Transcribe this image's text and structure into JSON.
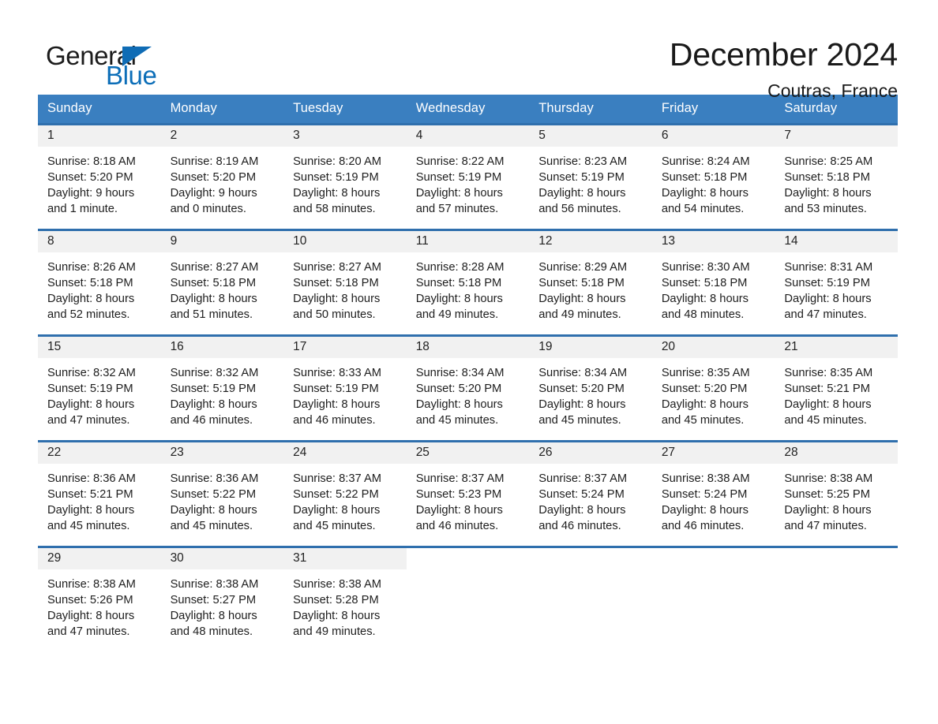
{
  "brand": {
    "name_part1": "General",
    "name_part2": "Blue",
    "triangle_color": "#0f6cb5",
    "blue_color": "#0c6eb8"
  },
  "header": {
    "month_title": "December 2024",
    "location": "Coutras, France"
  },
  "theme": {
    "header_blue": "#3a7fc0",
    "row_divider_blue": "#2f6fad",
    "daynum_band": "#f1f1f1"
  },
  "calendar": {
    "weekday_headers": [
      "Sunday",
      "Monday",
      "Tuesday",
      "Wednesday",
      "Thursday",
      "Friday",
      "Saturday"
    ],
    "weeks": [
      [
        {
          "day": "1",
          "sunrise": "Sunrise: 8:18 AM",
          "sunset": "Sunset: 5:20 PM",
          "daylight_line1": "Daylight: 9 hours",
          "daylight_line2": "and 1 minute."
        },
        {
          "day": "2",
          "sunrise": "Sunrise: 8:19 AM",
          "sunset": "Sunset: 5:20 PM",
          "daylight_line1": "Daylight: 9 hours",
          "daylight_line2": "and 0 minutes."
        },
        {
          "day": "3",
          "sunrise": "Sunrise: 8:20 AM",
          "sunset": "Sunset: 5:19 PM",
          "daylight_line1": "Daylight: 8 hours",
          "daylight_line2": "and 58 minutes."
        },
        {
          "day": "4",
          "sunrise": "Sunrise: 8:22 AM",
          "sunset": "Sunset: 5:19 PM",
          "daylight_line1": "Daylight: 8 hours",
          "daylight_line2": "and 57 minutes."
        },
        {
          "day": "5",
          "sunrise": "Sunrise: 8:23 AM",
          "sunset": "Sunset: 5:19 PM",
          "daylight_line1": "Daylight: 8 hours",
          "daylight_line2": "and 56 minutes."
        },
        {
          "day": "6",
          "sunrise": "Sunrise: 8:24 AM",
          "sunset": "Sunset: 5:18 PM",
          "daylight_line1": "Daylight: 8 hours",
          "daylight_line2": "and 54 minutes."
        },
        {
          "day": "7",
          "sunrise": "Sunrise: 8:25 AM",
          "sunset": "Sunset: 5:18 PM",
          "daylight_line1": "Daylight: 8 hours",
          "daylight_line2": "and 53 minutes."
        }
      ],
      [
        {
          "day": "8",
          "sunrise": "Sunrise: 8:26 AM",
          "sunset": "Sunset: 5:18 PM",
          "daylight_line1": "Daylight: 8 hours",
          "daylight_line2": "and 52 minutes."
        },
        {
          "day": "9",
          "sunrise": "Sunrise: 8:27 AM",
          "sunset": "Sunset: 5:18 PM",
          "daylight_line1": "Daylight: 8 hours",
          "daylight_line2": "and 51 minutes."
        },
        {
          "day": "10",
          "sunrise": "Sunrise: 8:27 AM",
          "sunset": "Sunset: 5:18 PM",
          "daylight_line1": "Daylight: 8 hours",
          "daylight_line2": "and 50 minutes."
        },
        {
          "day": "11",
          "sunrise": "Sunrise: 8:28 AM",
          "sunset": "Sunset: 5:18 PM",
          "daylight_line1": "Daylight: 8 hours",
          "daylight_line2": "and 49 minutes."
        },
        {
          "day": "12",
          "sunrise": "Sunrise: 8:29 AM",
          "sunset": "Sunset: 5:18 PM",
          "daylight_line1": "Daylight: 8 hours",
          "daylight_line2": "and 49 minutes."
        },
        {
          "day": "13",
          "sunrise": "Sunrise: 8:30 AM",
          "sunset": "Sunset: 5:18 PM",
          "daylight_line1": "Daylight: 8 hours",
          "daylight_line2": "and 48 minutes."
        },
        {
          "day": "14",
          "sunrise": "Sunrise: 8:31 AM",
          "sunset": "Sunset: 5:19 PM",
          "daylight_line1": "Daylight: 8 hours",
          "daylight_line2": "and 47 minutes."
        }
      ],
      [
        {
          "day": "15",
          "sunrise": "Sunrise: 8:32 AM",
          "sunset": "Sunset: 5:19 PM",
          "daylight_line1": "Daylight: 8 hours",
          "daylight_line2": "and 47 minutes."
        },
        {
          "day": "16",
          "sunrise": "Sunrise: 8:32 AM",
          "sunset": "Sunset: 5:19 PM",
          "daylight_line1": "Daylight: 8 hours",
          "daylight_line2": "and 46 minutes."
        },
        {
          "day": "17",
          "sunrise": "Sunrise: 8:33 AM",
          "sunset": "Sunset: 5:19 PM",
          "daylight_line1": "Daylight: 8 hours",
          "daylight_line2": "and 46 minutes."
        },
        {
          "day": "18",
          "sunrise": "Sunrise: 8:34 AM",
          "sunset": "Sunset: 5:20 PM",
          "daylight_line1": "Daylight: 8 hours",
          "daylight_line2": "and 45 minutes."
        },
        {
          "day": "19",
          "sunrise": "Sunrise: 8:34 AM",
          "sunset": "Sunset: 5:20 PM",
          "daylight_line1": "Daylight: 8 hours",
          "daylight_line2": "and 45 minutes."
        },
        {
          "day": "20",
          "sunrise": "Sunrise: 8:35 AM",
          "sunset": "Sunset: 5:20 PM",
          "daylight_line1": "Daylight: 8 hours",
          "daylight_line2": "and 45 minutes."
        },
        {
          "day": "21",
          "sunrise": "Sunrise: 8:35 AM",
          "sunset": "Sunset: 5:21 PM",
          "daylight_line1": "Daylight: 8 hours",
          "daylight_line2": "and 45 minutes."
        }
      ],
      [
        {
          "day": "22",
          "sunrise": "Sunrise: 8:36 AM",
          "sunset": "Sunset: 5:21 PM",
          "daylight_line1": "Daylight: 8 hours",
          "daylight_line2": "and 45 minutes."
        },
        {
          "day": "23",
          "sunrise": "Sunrise: 8:36 AM",
          "sunset": "Sunset: 5:22 PM",
          "daylight_line1": "Daylight: 8 hours",
          "daylight_line2": "and 45 minutes."
        },
        {
          "day": "24",
          "sunrise": "Sunrise: 8:37 AM",
          "sunset": "Sunset: 5:22 PM",
          "daylight_line1": "Daylight: 8 hours",
          "daylight_line2": "and 45 minutes."
        },
        {
          "day": "25",
          "sunrise": "Sunrise: 8:37 AM",
          "sunset": "Sunset: 5:23 PM",
          "daylight_line1": "Daylight: 8 hours",
          "daylight_line2": "and 46 minutes."
        },
        {
          "day": "26",
          "sunrise": "Sunrise: 8:37 AM",
          "sunset": "Sunset: 5:24 PM",
          "daylight_line1": "Daylight: 8 hours",
          "daylight_line2": "and 46 minutes."
        },
        {
          "day": "27",
          "sunrise": "Sunrise: 8:38 AM",
          "sunset": "Sunset: 5:24 PM",
          "daylight_line1": "Daylight: 8 hours",
          "daylight_line2": "and 46 minutes."
        },
        {
          "day": "28",
          "sunrise": "Sunrise: 8:38 AM",
          "sunset": "Sunset: 5:25 PM",
          "daylight_line1": "Daylight: 8 hours",
          "daylight_line2": "and 47 minutes."
        }
      ],
      [
        {
          "day": "29",
          "sunrise": "Sunrise: 8:38 AM",
          "sunset": "Sunset: 5:26 PM",
          "daylight_line1": "Daylight: 8 hours",
          "daylight_line2": "and 47 minutes."
        },
        {
          "day": "30",
          "sunrise": "Sunrise: 8:38 AM",
          "sunset": "Sunset: 5:27 PM",
          "daylight_line1": "Daylight: 8 hours",
          "daylight_line2": "and 48 minutes."
        },
        {
          "day": "31",
          "sunrise": "Sunrise: 8:38 AM",
          "sunset": "Sunset: 5:28 PM",
          "daylight_line1": "Daylight: 8 hours",
          "daylight_line2": "and 49 minutes."
        },
        {
          "day": "",
          "sunrise": "",
          "sunset": "",
          "daylight_line1": "",
          "daylight_line2": ""
        },
        {
          "day": "",
          "sunrise": "",
          "sunset": "",
          "daylight_line1": "",
          "daylight_line2": ""
        },
        {
          "day": "",
          "sunrise": "",
          "sunset": "",
          "daylight_line1": "",
          "daylight_line2": ""
        },
        {
          "day": "",
          "sunrise": "",
          "sunset": "",
          "daylight_line1": "",
          "daylight_line2": ""
        }
      ]
    ]
  }
}
